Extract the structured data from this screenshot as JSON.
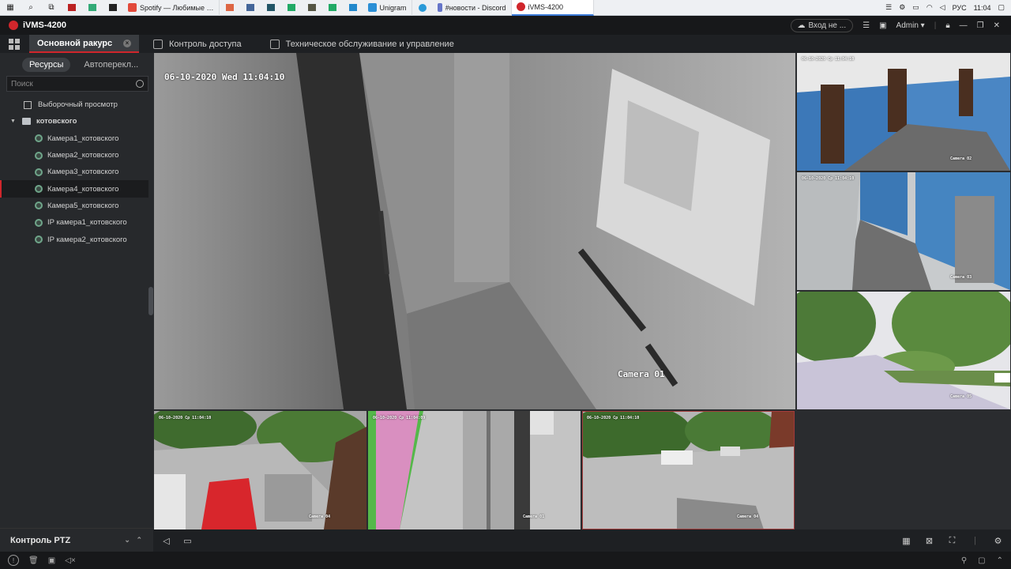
{
  "taskbar": {
    "apps": [
      {
        "label": "Spotify — Любимые …",
        "color": "#e24a3b"
      },
      {
        "label": "Unigram",
        "color": "#2b8fd6"
      },
      {
        "label": "#новости - Discord",
        "color": "#6675c9"
      },
      {
        "label": "iVMS-4200",
        "color": "#d0262c"
      }
    ],
    "lang": "РУС",
    "time": "11:04"
  },
  "titlebar": {
    "app_title": "iVMS-4200",
    "login_label": "Вход не ...",
    "user": "Admin"
  },
  "tabs": [
    {
      "label": "Основной ракурс"
    },
    {
      "label": "Контроль доступа"
    },
    {
      "label": "Техническое обслуживание и управление"
    }
  ],
  "left": {
    "subtab_resources": "Ресурсы",
    "subtab_auto": "Автоперекл...",
    "search_placeholder": "Поиск",
    "custom_view": "Выборочный просмотр",
    "group": "котовского",
    "cameras": [
      "Камера1_котовского",
      "Камера2_котовского",
      "Камера3_котовского",
      "Камера4_котовского",
      "Камера5_котовского",
      "IP камера1_котовского",
      "IP камера2_котовского"
    ],
    "ptz_label": "Контроль PTZ"
  },
  "video": {
    "main_timestamp": "06-10-2020 Wed 11:04:10",
    "main_camera": "Camera 01",
    "small_timestamp_a": "06-10-2020 Ср 11:04:10",
    "small_timestamp_b": "06-10-2020 Ср 11:04:09",
    "cam_02": "Camera 02",
    "cam_03": "Camera 03",
    "cam_04": "Camera 04",
    "cam_05": "Camera 05",
    "cam_01b": "Camera 01"
  }
}
